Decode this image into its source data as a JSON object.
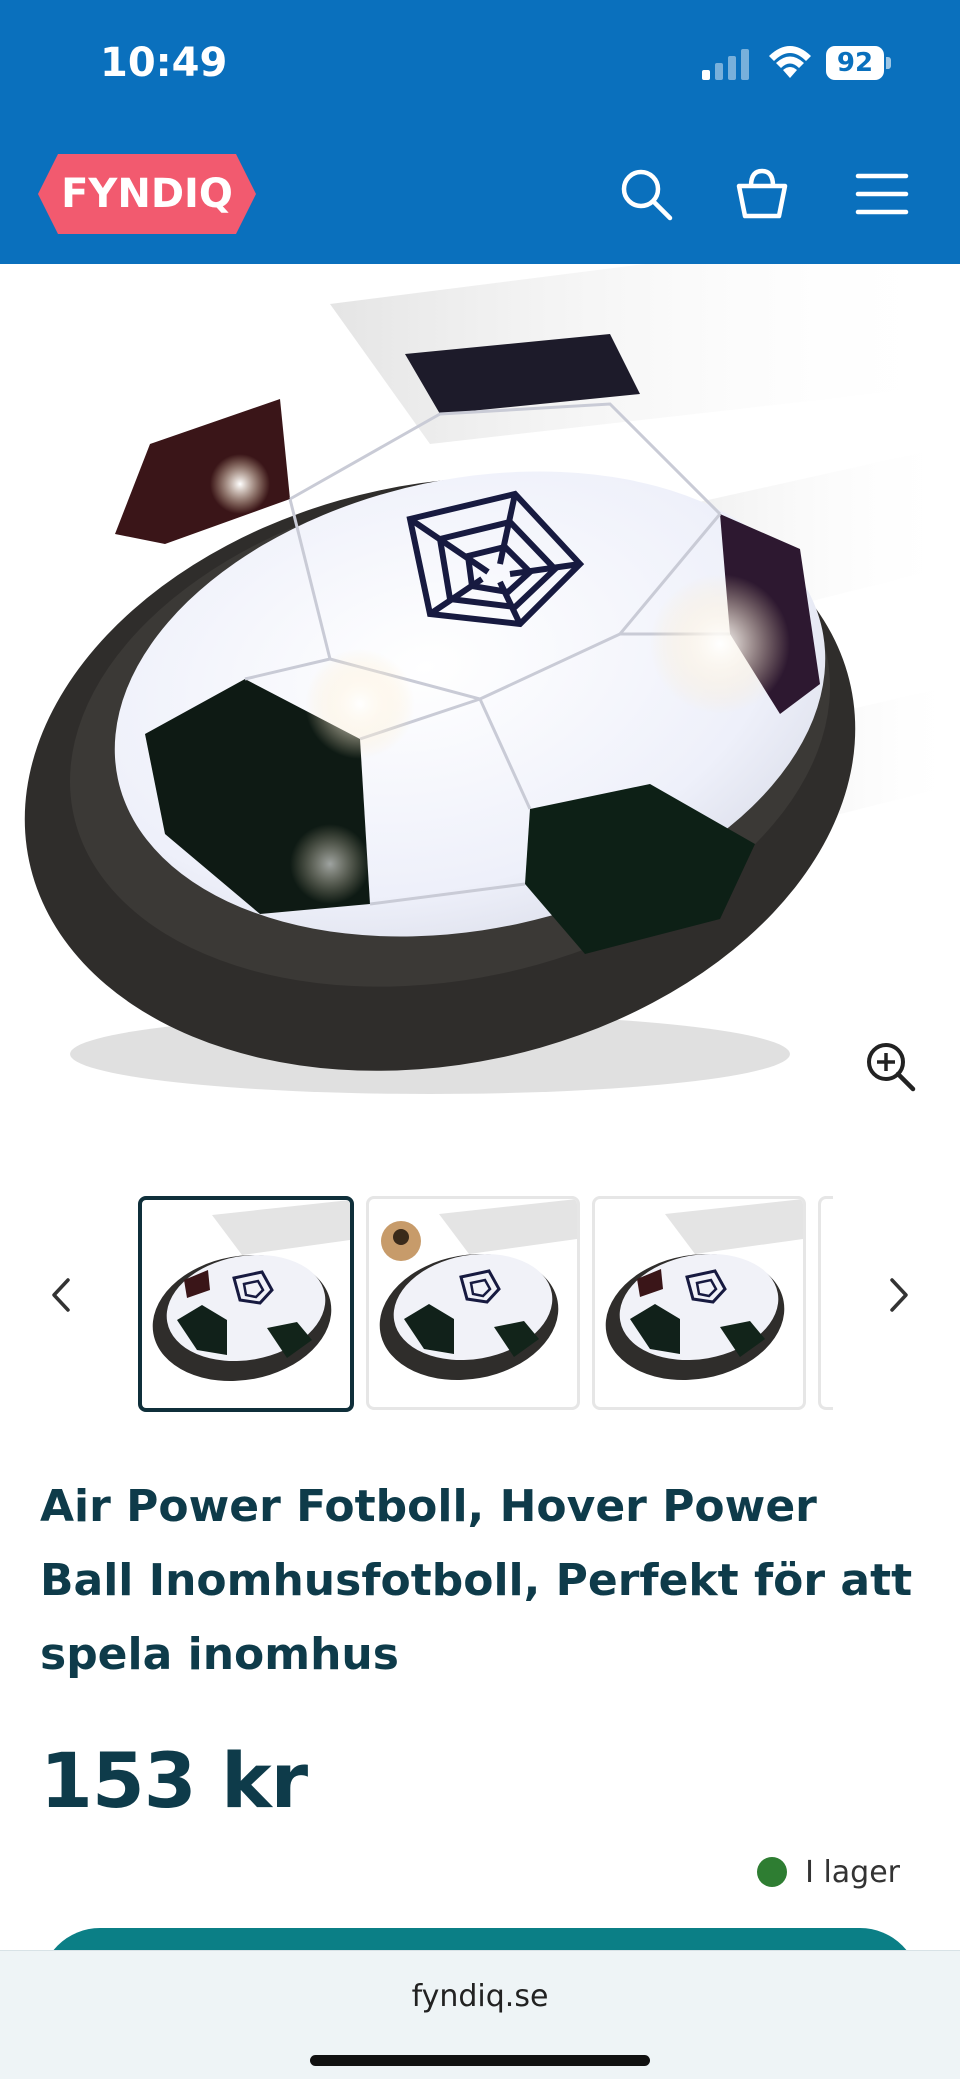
{
  "status": {
    "time": "10:49",
    "battery": "92"
  },
  "header": {
    "logo_text": "FYNDIQ",
    "icons": [
      "search-icon",
      "cart-icon",
      "menu-icon"
    ],
    "brand_color": "#0a70bd",
    "logo_color": "#f25a6f"
  },
  "gallery": {
    "prev_icon": "chevron-left-icon",
    "next_icon": "chevron-right-icon",
    "zoom_icon": "zoom-in-icon",
    "thumb_count_visible": 3,
    "active_thumb": 1
  },
  "product": {
    "title": "Air Power Fotboll, Hover Power Ball Inomhusfotboll, Perfekt för att spela inomhus",
    "price": "153 kr",
    "stock_label": "I lager",
    "stock_color": "#2e7d32"
  },
  "browser": {
    "url": "fyndiq.se"
  }
}
